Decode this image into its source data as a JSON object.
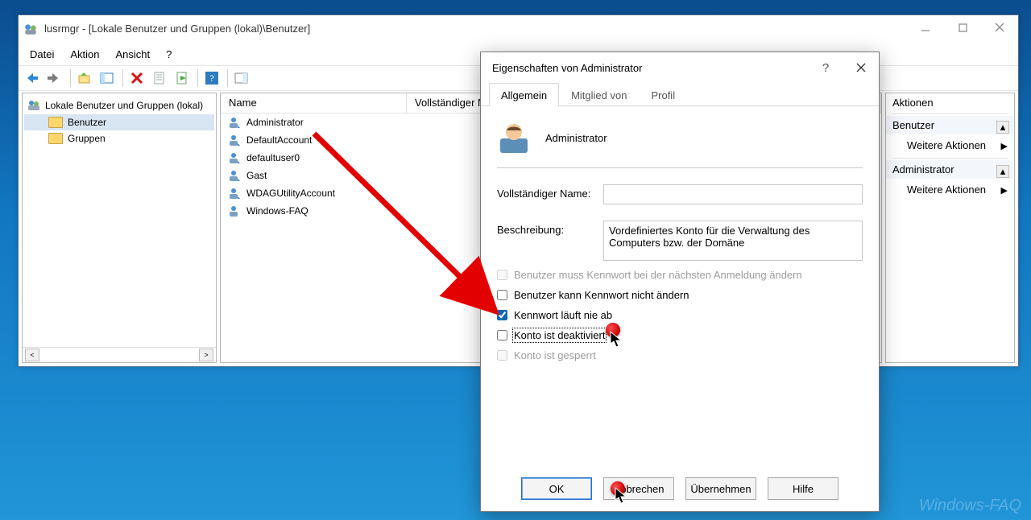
{
  "mmc": {
    "title": "lusrmgr - [Lokale Benutzer und Gruppen (lokal)\\Benutzer]",
    "menus": [
      "Datei",
      "Aktion",
      "Ansicht",
      "?"
    ],
    "tree": {
      "root": "Lokale Benutzer und Gruppen (lokal)",
      "children": [
        {
          "label": "Benutzer",
          "selected": true
        },
        {
          "label": "Gruppen",
          "selected": false
        }
      ]
    },
    "list": {
      "columns": [
        "Name",
        "Vollständiger Name"
      ],
      "rows": [
        "Administrator",
        "DefaultAccount",
        "defaultuser0",
        "Gast",
        "WDAGUtilityAccount",
        "Windows-FAQ"
      ]
    },
    "actions": {
      "header1": "Benutzer",
      "item1": "Weitere Aktionen",
      "header2": "Administrator",
      "item2": "Weitere Aktionen"
    }
  },
  "dialog": {
    "title": "Eigenschaften von Administrator",
    "tabs": [
      "Allgemein",
      "Mitglied von",
      "Profil"
    ],
    "account_name": "Administrator",
    "full_name_label": "Vollständiger Name:",
    "full_name_value": "",
    "description_label": "Beschreibung:",
    "description_value": "Vordefiniertes Konto für die Verwaltung des Computers bzw. der Domäne",
    "checks": {
      "must_change": "Benutzer muss Kennwort bei der nächsten Anmeldung ändern",
      "cannot_change": "Benutzer kann Kennwort nicht ändern",
      "no_expire": "Kennwort läuft nie ab",
      "disabled": "Konto ist deaktiviert",
      "locked": "Konto ist gesperrt"
    },
    "buttons": {
      "ok": "OK",
      "cancel": "Abbrechen",
      "apply": "Übernehmen",
      "help": "Hilfe"
    }
  },
  "watermark": "Windows-FAQ"
}
